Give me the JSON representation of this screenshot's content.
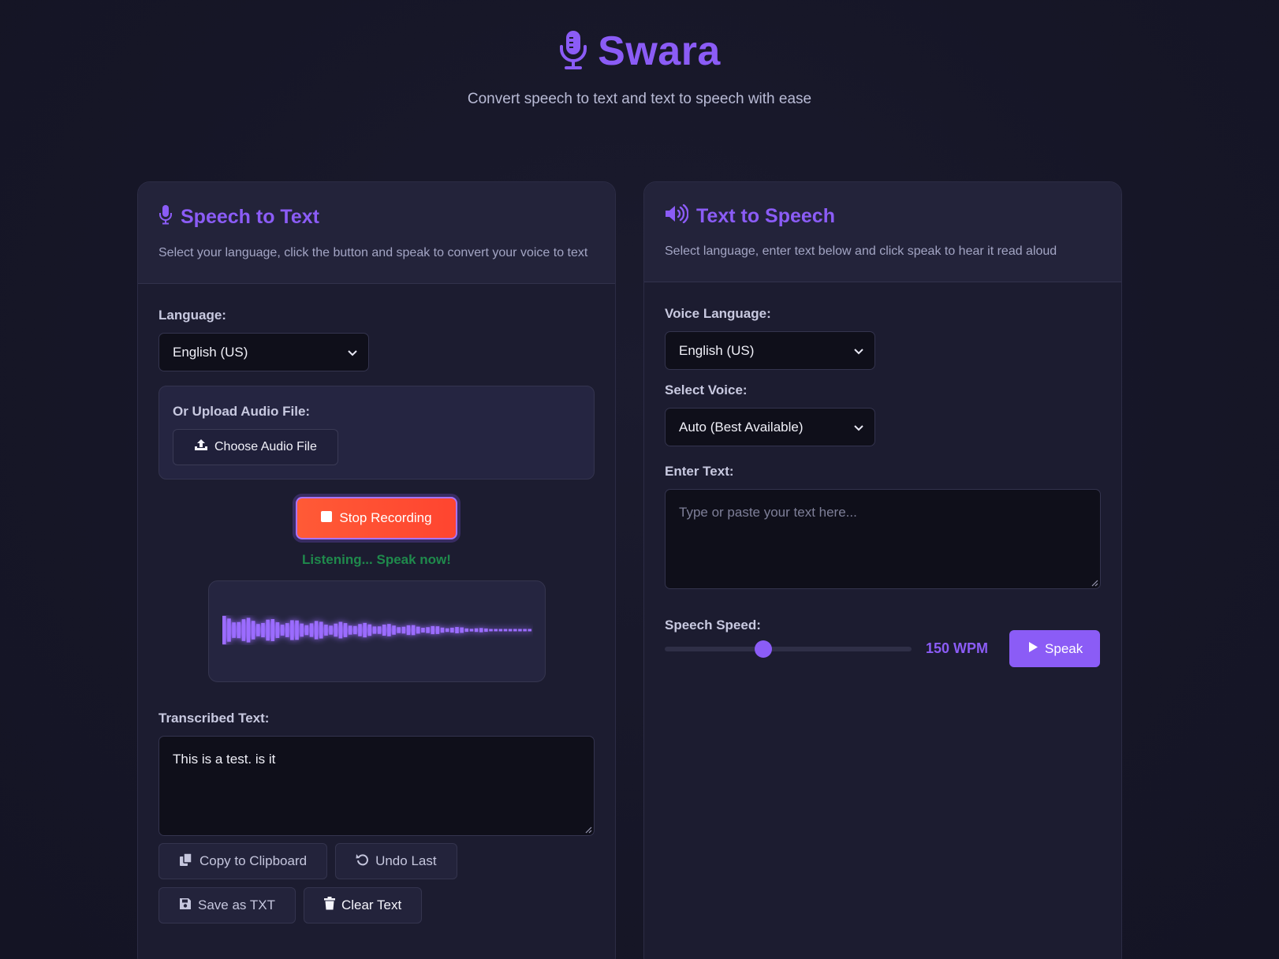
{
  "app": {
    "title": "Swara",
    "subtitle": "Convert speech to text and text to speech with ease",
    "accent_color": "#8b5cf6"
  },
  "speech_to_text": {
    "title": "Speech to Text",
    "description": "Select your language, click the button and speak to convert your voice to text",
    "language_label": "Language:",
    "language_value": "English (US)",
    "upload_label": "Or Upload Audio File:",
    "upload_button": "Choose Audio File",
    "stop_button": "Stop Recording",
    "status_text": "Listening... Speak now!",
    "status_color": "#1f8a4c",
    "transcribed_label": "Transcribed Text:",
    "transcribed_value": "This is a test. is it",
    "actions": {
      "copy": "Copy to Clipboard",
      "undo": "Undo Last",
      "save": "Save as TXT",
      "clear": "Clear Text"
    }
  },
  "text_to_speech": {
    "title": "Text to Speech",
    "description": "Select language, enter text below and click speak to hear it read aloud",
    "voice_language_label": "Voice Language:",
    "voice_language_value": "English (US)",
    "select_voice_label": "Select Voice:",
    "select_voice_value": "Auto (Best Available)",
    "enter_text_label": "Enter Text:",
    "enter_text_placeholder": "Type or paste your text here...",
    "speed_label": "Speech Speed:",
    "speed_value": "150 WPM",
    "speed_fraction": 0.4,
    "speak_button": "Speak"
  }
}
